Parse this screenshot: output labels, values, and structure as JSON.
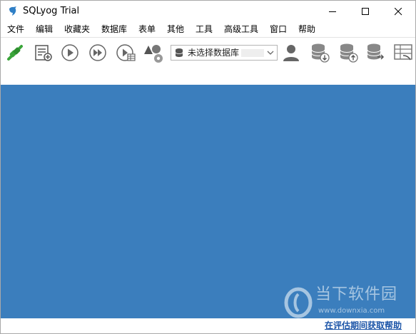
{
  "window": {
    "title": "SQLyog Trial"
  },
  "menu": {
    "items": [
      "文件",
      "编辑",
      "收藏夹",
      "数据库",
      "表单",
      "其他",
      "工具",
      "高级工具",
      "窗口",
      "帮助"
    ]
  },
  "toolbar": {
    "db_select_value": "未选择数据库"
  },
  "watermark": {
    "name": "当下软件园",
    "url": "www.downxia.com"
  },
  "status": {
    "help_link": "在评估期间获取帮助"
  },
  "colors": {
    "main_background": "#3b7ebd",
    "accent_green": "#3aa53a",
    "link": "#1c55a8"
  }
}
